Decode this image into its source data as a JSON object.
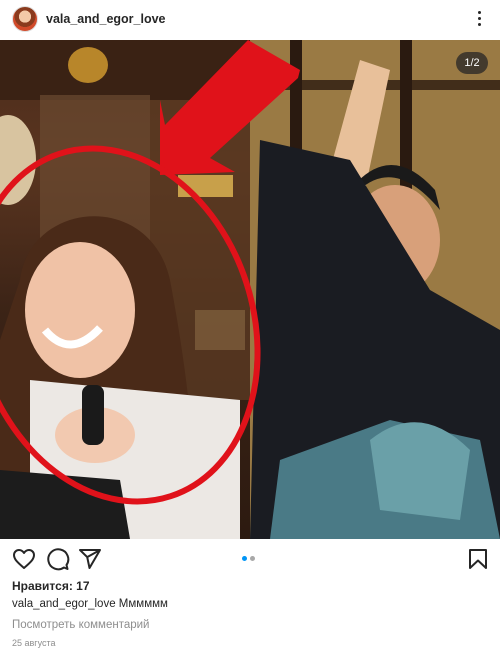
{
  "post": {
    "username": "vala_and_egor_love",
    "page_counter": "1/2",
    "likes_text": "Нравится: 17",
    "caption_user": "vala_and_egor_love",
    "caption_text": "Мммммм",
    "comment_placeholder": "Посмотреть комментарий",
    "date": "25 августа",
    "carousel": {
      "current": 1,
      "total": 2
    }
  },
  "colors": {
    "annotation_red": "#e0121a",
    "carousel_active": "#0095f6",
    "carousel_inactive": "#a8a8a8",
    "text_muted": "#8e8e8e"
  },
  "icons": [
    "heart-icon",
    "comment-icon",
    "share-icon",
    "bookmark-icon",
    "more-options-icon"
  ]
}
